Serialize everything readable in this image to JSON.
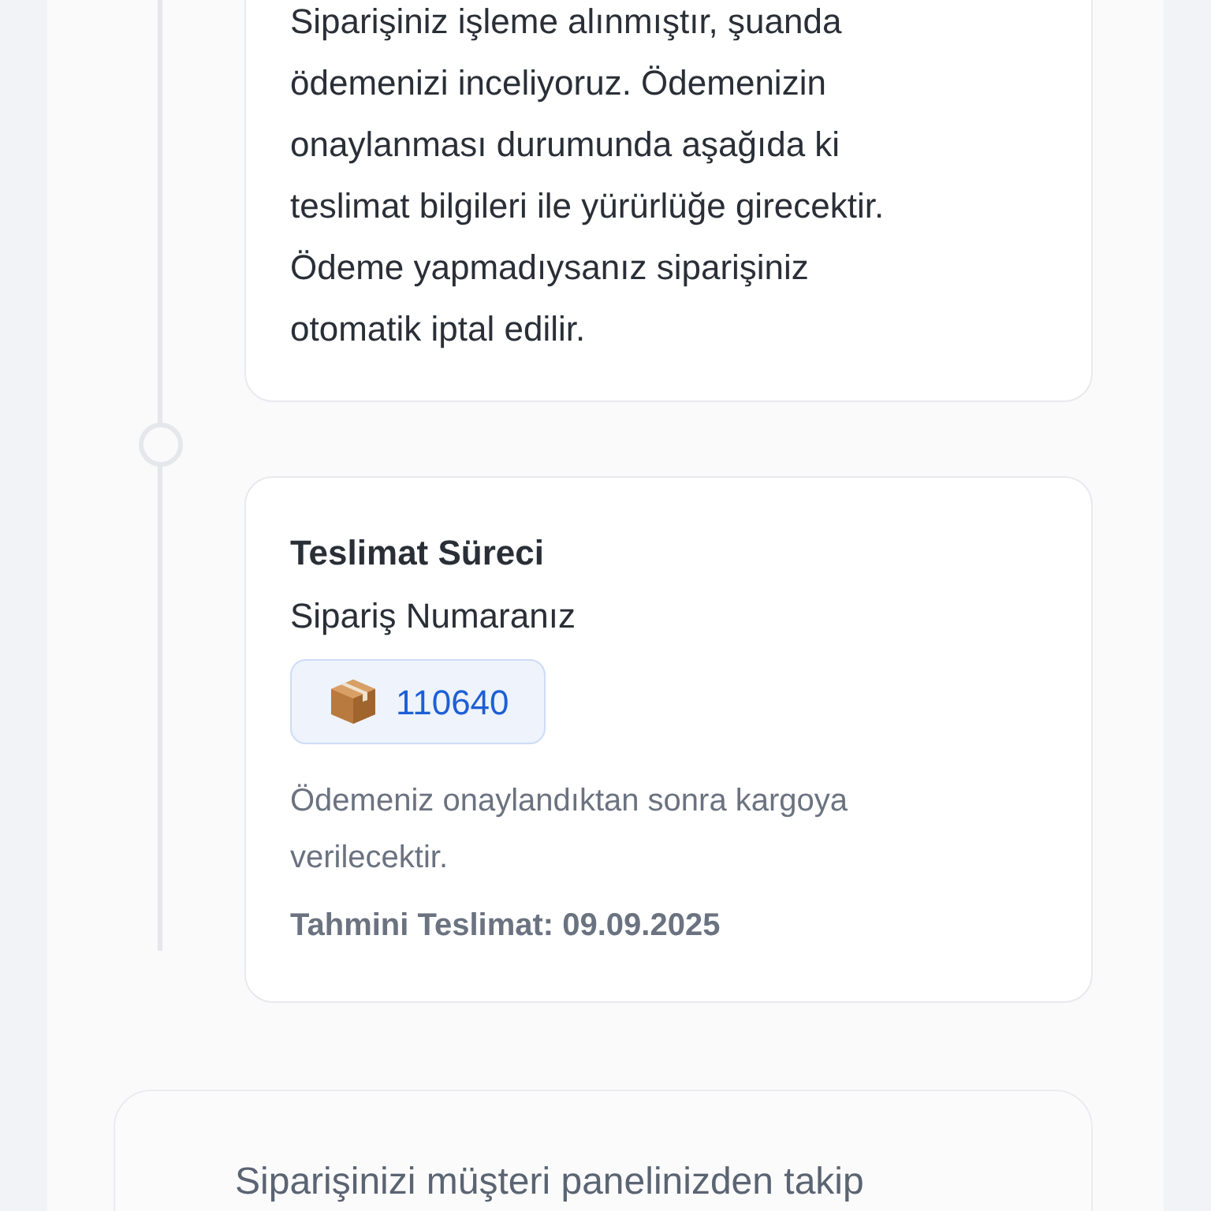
{
  "status_card": {
    "message": "Siparişiniz işleme alınmıştır, şuanda\nödemenizi inceliyoruz. Ödemenizin\nonaylanması durumunda aşağıda ki\nteslimat bilgileri ile yürürlüğe girecektir.\nÖdeme yapmadıysanız siparişiniz\notomatik iptal edilir."
  },
  "delivery_card": {
    "title": "Teslimat Süreci",
    "order_label": "Sipariş Numaranız",
    "order_number": "110640",
    "note": "Ödemeniz onaylandıktan sonra kargoya\nverilecektir.",
    "estimate": "Tahmini Teslimat: 09.09.2025"
  },
  "footer_card": {
    "text": "Siparişinizi müşteri panelinizden takip"
  }
}
